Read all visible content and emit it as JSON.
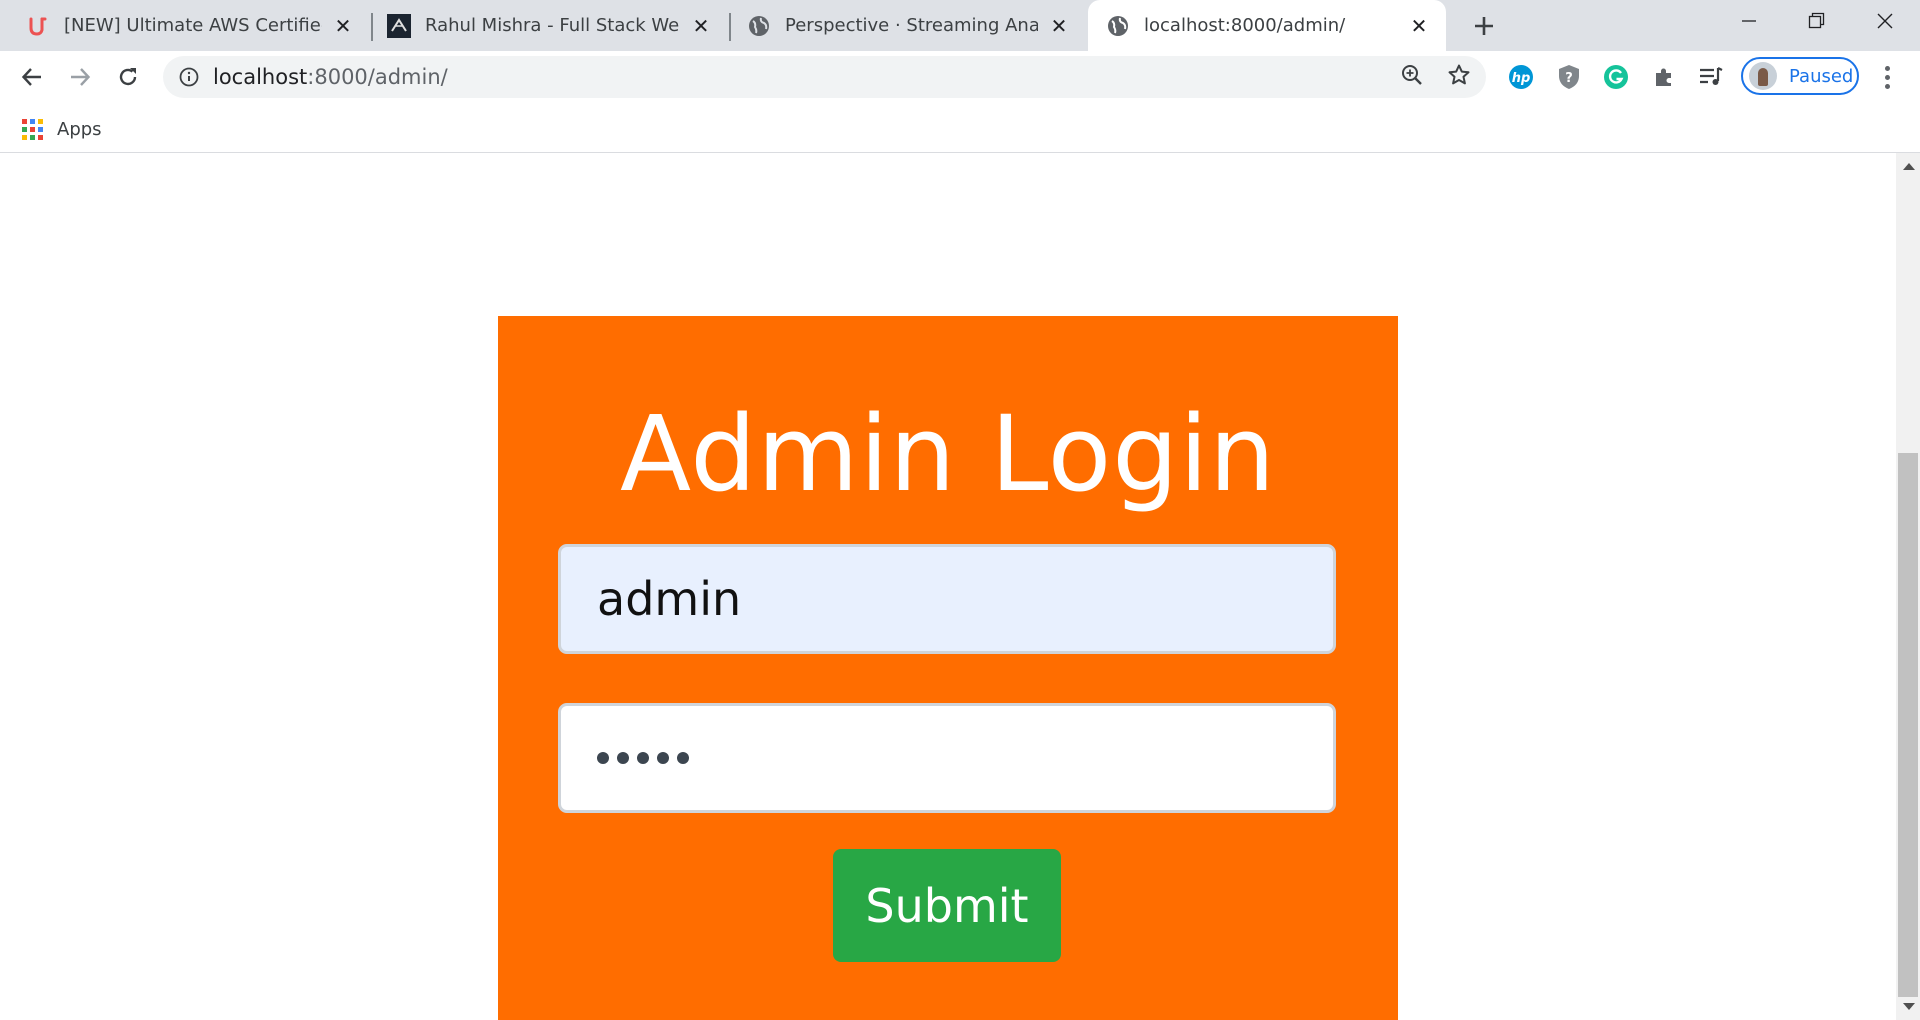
{
  "browser": {
    "tabs": [
      {
        "title": "[NEW] Ultimate AWS Certified Cl",
        "favicon": "udemy-icon",
        "active": false
      },
      {
        "title": "Rahul Mishra - Full Stack Web De",
        "favicon": "site-logo-icon",
        "active": false
      },
      {
        "title": "Perspective · Streaming Analytics",
        "favicon": "globe-icon",
        "active": false
      },
      {
        "title": "localhost:8000/admin/",
        "favicon": "globe-icon",
        "active": true
      }
    ],
    "address": {
      "host": "localhost",
      "path": ":8000/admin/"
    },
    "profile_label": "Paused",
    "bookmarks": {
      "apps_label": "Apps"
    }
  },
  "page": {
    "heading": "Admin Login",
    "username_value": "admin",
    "password_mask_count": 5,
    "submit_label": "Submit",
    "card_color": "#ff6d00",
    "submit_color": "#28a745"
  }
}
